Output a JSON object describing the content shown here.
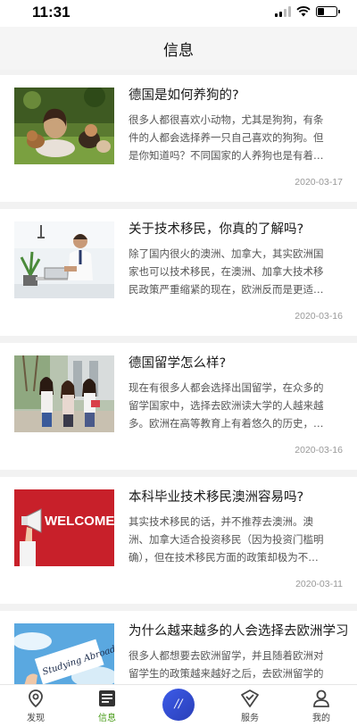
{
  "status_bar": {
    "time": "11:31",
    "battery_level": 0.35
  },
  "nav": {
    "title": "信息"
  },
  "articles": [
    {
      "title": "德国是如何养狗的?",
      "summary": "很多人都很喜欢小动物，尤其是狗狗，有条件的人都会选择养一只自己喜欢的狗狗。但是你知道吗？不同国家的人养狗也是有着…",
      "date": "2020-03-17",
      "image": "woman-with-dogs-on-grass"
    },
    {
      "title": "关于技术移民，你真的了解吗?",
      "summary": "除了国内很火的澳洲、加拿大，其实欧洲国家也可以技术移民，在澳洲、加拿大技术移民政策严重缩紧的现在，欧洲反而是更适…",
      "date": "2020-03-16",
      "image": "man-working-at-laptop"
    },
    {
      "title": "德国留学怎么样?",
      "summary": "现在有很多人都会选择出国留学，在众多的留学国家中，选择去欧洲读大学的人越来越多。欧洲在高等教育上有着悠久的历史，…",
      "date": "2020-03-16",
      "image": "students-on-campus"
    },
    {
      "title": "本科毕业技术移民澳洲容易吗?",
      "summary": "其实技术移民的话，并不推荐去澳洲。澳洲、加拿大适合投资移民（因为投资门槛明确），但在技术移民方面的政策却极为不…",
      "date": "2020-03-11",
      "image": "welcome-megaphone",
      "image_text": "WELCOME"
    },
    {
      "title": "为什么越来越多的人会选择去欧洲学习?",
      "summary": "很多人都想要去欧洲留学，并且随着欧洲对留学生的政策越来越好之后，去欧洲留学的人就更多了。那么，为什么这么多的人都…",
      "date": "",
      "image": "studying-abroad-card",
      "image_text": "Studying Abroad?"
    }
  ],
  "tabs": [
    {
      "label": "发现",
      "icon": "location-pin-icon"
    },
    {
      "label": "信息",
      "icon": "document-list-icon",
      "active": true
    },
    {
      "label": "",
      "icon": "app-logo-icon",
      "logo_text": "//"
    },
    {
      "label": "服务",
      "icon": "service-check-icon"
    },
    {
      "label": "我的",
      "icon": "profile-icon"
    }
  ],
  "colors": {
    "active_tab": "#4a9c1a",
    "center_button": "#2f48d0",
    "welcome_bg": "#c8202a"
  }
}
